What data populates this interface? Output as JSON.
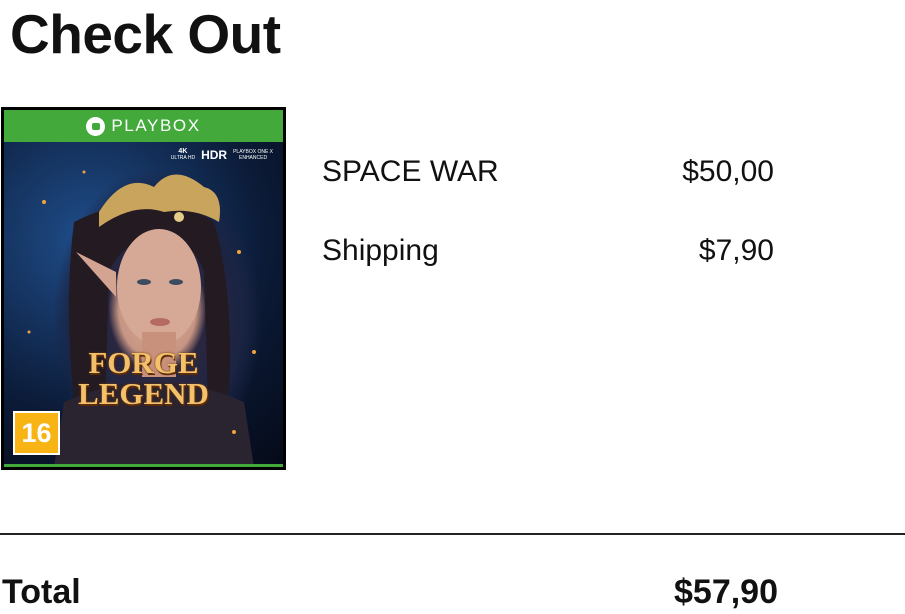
{
  "page": {
    "title": "Check Out"
  },
  "product_cover": {
    "brand": "PLAYBOX",
    "badges": {
      "resolution_top": "4K",
      "resolution_bottom": "ULTRA HD",
      "hdr": "HDR",
      "enhanced_top": "PLAYBOX ONE X",
      "enhanced_bottom": "ENHANCED"
    },
    "title_line1": "FORGE",
    "title_line2": "LEGEND",
    "age_rating": "16",
    "colors": {
      "banner": "#43a93b",
      "age_badge": "#f8b415"
    }
  },
  "order": {
    "items": [
      {
        "label": "SPACE WAR",
        "price": "$50,00"
      },
      {
        "label": "Shipping",
        "price": "$7,90"
      }
    ],
    "total": {
      "label": "Total",
      "amount": "$57,90"
    }
  }
}
